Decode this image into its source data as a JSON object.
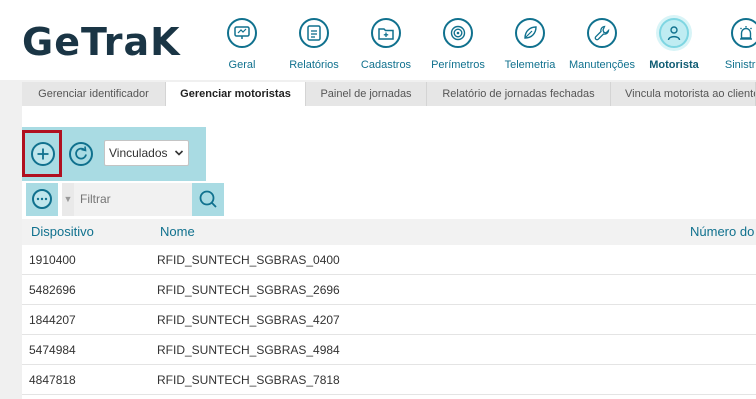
{
  "logo": "GeTraK",
  "nav": [
    {
      "label": "Geral",
      "icon": "monitor-chart-icon",
      "active": false
    },
    {
      "label": "Relatórios",
      "icon": "report-list-icon",
      "active": false
    },
    {
      "label": "Cadastros",
      "icon": "folder-plus-icon",
      "active": false
    },
    {
      "label": "Perímetros",
      "icon": "target-icon",
      "active": false
    },
    {
      "label": "Telemetria",
      "icon": "leaf-icon",
      "active": false
    },
    {
      "label": "Manutenções",
      "icon": "wrench-icon",
      "active": false
    },
    {
      "label": "Motorista",
      "icon": "driver-icon",
      "active": true
    },
    {
      "label": "Sinistros",
      "icon": "alarm-icon",
      "active": false
    }
  ],
  "tabs": [
    {
      "label": "Gerenciar identificador",
      "active": false
    },
    {
      "label": "Gerenciar motoristas",
      "active": true
    },
    {
      "label": "Painel de jornadas",
      "active": false
    },
    {
      "label": "Relatório de jornadas fechadas",
      "active": false
    },
    {
      "label": "Vincula motorista ao cliente",
      "active": false
    }
  ],
  "toolbar": {
    "select_value": "Vinculados",
    "add_icon": "plus-circle-icon",
    "refresh_icon": "refresh-icon"
  },
  "filter": {
    "placeholder": "Filtrar",
    "more_icon": "more-options-icon",
    "search_icon": "search-icon"
  },
  "table": {
    "headers": [
      "Dispositivo",
      "Nome",
      "Número do"
    ],
    "rows": [
      {
        "dispositivo": "1910400",
        "nome": "RFID_SUNTECH_SGBRAS_0400"
      },
      {
        "dispositivo": "5482696",
        "nome": "RFID_SUNTECH_SGBRAS_2696"
      },
      {
        "dispositivo": "1844207",
        "nome": "RFID_SUNTECH_SGBRAS_4207"
      },
      {
        "dispositivo": "5474984",
        "nome": "RFID_SUNTECH_SGBRAS_4984"
      },
      {
        "dispositivo": "4847818",
        "nome": "RFID_SUNTECH_SGBRAS_7818"
      }
    ]
  },
  "colors": {
    "brand": "#10718e",
    "highlight": "#b01020",
    "toolbar_bg": "#a9dbe3"
  }
}
